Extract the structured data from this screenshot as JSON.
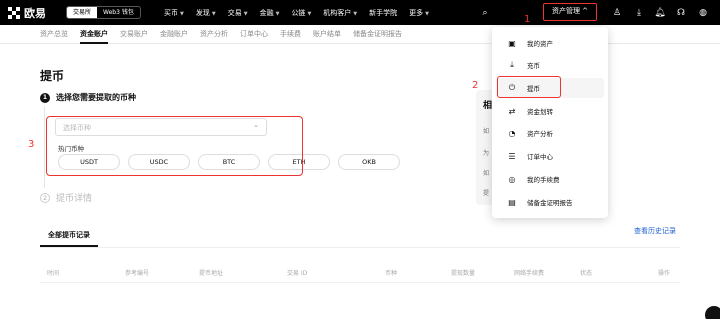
{
  "brand": {
    "name": "欧易"
  },
  "exchange_toggle": [
    "交易所",
    "Web3 钱包"
  ],
  "nav": {
    "items": [
      {
        "label": "买币",
        "caret": true
      },
      {
        "label": "发现",
        "caret": true
      },
      {
        "label": "交易",
        "caret": true
      },
      {
        "label": "金融",
        "caret": true
      },
      {
        "label": "公链",
        "caret": true
      },
      {
        "label": "机构客户",
        "caret": true
      },
      {
        "label": "新手学院",
        "caret": false
      },
      {
        "label": "更多",
        "caret": true
      }
    ],
    "asset_management": "资产管理 ^"
  },
  "annotations": {
    "one": "1",
    "two": "2",
    "three": "3"
  },
  "subnav": [
    "资产总览",
    "资金账户",
    "交易账户",
    "金融账户",
    "资产分析",
    "订单中心",
    "手续费",
    "账户结单",
    "储备金证明报告"
  ],
  "page": {
    "title": "提币",
    "step1": {
      "num": "1",
      "label": "选择您需要提取的币种"
    },
    "select_placeholder": "选择币种",
    "hot_label": "热门币种",
    "chips": [
      "USDT",
      "USDC",
      "BTC",
      "ETH",
      "OKB"
    ],
    "step2": {
      "num": "2",
      "label": "提币详情"
    },
    "records_tab": "全部提币记录",
    "history_link": "查看历史记录",
    "table_headers": [
      "时间",
      "参考编号",
      "提币地址",
      "交易 ID",
      "币种",
      "提现数量",
      "网络手续费",
      "状态",
      "操作"
    ]
  },
  "side_panel": {
    "header": "相",
    "rows": [
      "如",
      "为",
      "如",
      "提"
    ]
  },
  "dropdown": [
    {
      "icon": "wallet-icon",
      "glyph": "▣",
      "label": "我的资产"
    },
    {
      "icon": "deposit-icon",
      "glyph": "⤓",
      "label": "充币"
    },
    {
      "icon": "withdraw-icon",
      "glyph": "⏻",
      "label": "提币"
    },
    {
      "icon": "transfer-icon",
      "glyph": "⇄",
      "label": "资金划转"
    },
    {
      "icon": "analysis-icon",
      "glyph": "◔",
      "label": "资产分析"
    },
    {
      "icon": "orders-icon",
      "glyph": "☰",
      "label": "订单中心"
    },
    {
      "icon": "fees-icon",
      "glyph": "◎",
      "label": "我的手续费"
    },
    {
      "icon": "reserve-icon",
      "glyph": "▤",
      "label": "储备金证明报告"
    }
  ],
  "colors": {
    "annotation": "#e33333",
    "link": "#1f5fd1",
    "nav_bg": "#000000"
  }
}
